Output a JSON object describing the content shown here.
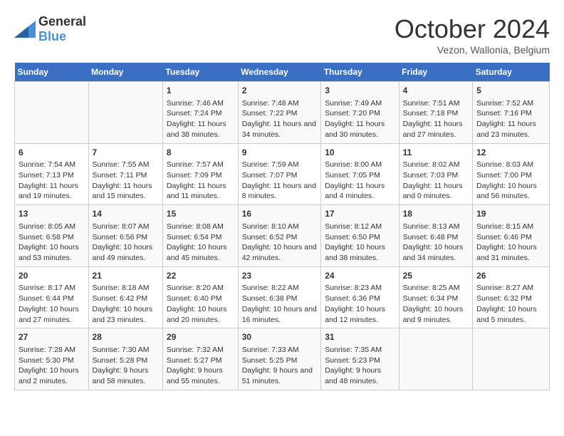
{
  "logo": {
    "text_general": "General",
    "text_blue": "Blue"
  },
  "title": "October 2024",
  "subtitle": "Vezon, Wallonia, Belgium",
  "days_of_week": [
    "Sunday",
    "Monday",
    "Tuesday",
    "Wednesday",
    "Thursday",
    "Friday",
    "Saturday"
  ],
  "weeks": [
    [
      {
        "day": "",
        "info": ""
      },
      {
        "day": "",
        "info": ""
      },
      {
        "day": "1",
        "info": "Sunrise: 7:46 AM\nSunset: 7:24 PM\nDaylight: 11 hours and 38 minutes."
      },
      {
        "day": "2",
        "info": "Sunrise: 7:48 AM\nSunset: 7:22 PM\nDaylight: 11 hours and 34 minutes."
      },
      {
        "day": "3",
        "info": "Sunrise: 7:49 AM\nSunset: 7:20 PM\nDaylight: 11 hours and 30 minutes."
      },
      {
        "day": "4",
        "info": "Sunrise: 7:51 AM\nSunset: 7:18 PM\nDaylight: 11 hours and 27 minutes."
      },
      {
        "day": "5",
        "info": "Sunrise: 7:52 AM\nSunset: 7:16 PM\nDaylight: 11 hours and 23 minutes."
      }
    ],
    [
      {
        "day": "6",
        "info": "Sunrise: 7:54 AM\nSunset: 7:13 PM\nDaylight: 11 hours and 19 minutes."
      },
      {
        "day": "7",
        "info": "Sunrise: 7:55 AM\nSunset: 7:11 PM\nDaylight: 11 hours and 15 minutes."
      },
      {
        "day": "8",
        "info": "Sunrise: 7:57 AM\nSunset: 7:09 PM\nDaylight: 11 hours and 11 minutes."
      },
      {
        "day": "9",
        "info": "Sunrise: 7:59 AM\nSunset: 7:07 PM\nDaylight: 11 hours and 8 minutes."
      },
      {
        "day": "10",
        "info": "Sunrise: 8:00 AM\nSunset: 7:05 PM\nDaylight: 11 hours and 4 minutes."
      },
      {
        "day": "11",
        "info": "Sunrise: 8:02 AM\nSunset: 7:03 PM\nDaylight: 11 hours and 0 minutes."
      },
      {
        "day": "12",
        "info": "Sunrise: 8:03 AM\nSunset: 7:00 PM\nDaylight: 10 hours and 56 minutes."
      }
    ],
    [
      {
        "day": "13",
        "info": "Sunrise: 8:05 AM\nSunset: 6:58 PM\nDaylight: 10 hours and 53 minutes."
      },
      {
        "day": "14",
        "info": "Sunrise: 8:07 AM\nSunset: 6:56 PM\nDaylight: 10 hours and 49 minutes."
      },
      {
        "day": "15",
        "info": "Sunrise: 8:08 AM\nSunset: 6:54 PM\nDaylight: 10 hours and 45 minutes."
      },
      {
        "day": "16",
        "info": "Sunrise: 8:10 AM\nSunset: 6:52 PM\nDaylight: 10 hours and 42 minutes."
      },
      {
        "day": "17",
        "info": "Sunrise: 8:12 AM\nSunset: 6:50 PM\nDaylight: 10 hours and 38 minutes."
      },
      {
        "day": "18",
        "info": "Sunrise: 8:13 AM\nSunset: 6:48 PM\nDaylight: 10 hours and 34 minutes."
      },
      {
        "day": "19",
        "info": "Sunrise: 8:15 AM\nSunset: 6:46 PM\nDaylight: 10 hours and 31 minutes."
      }
    ],
    [
      {
        "day": "20",
        "info": "Sunrise: 8:17 AM\nSunset: 6:44 PM\nDaylight: 10 hours and 27 minutes."
      },
      {
        "day": "21",
        "info": "Sunrise: 8:18 AM\nSunset: 6:42 PM\nDaylight: 10 hours and 23 minutes."
      },
      {
        "day": "22",
        "info": "Sunrise: 8:20 AM\nSunset: 6:40 PM\nDaylight: 10 hours and 20 minutes."
      },
      {
        "day": "23",
        "info": "Sunrise: 8:22 AM\nSunset: 6:38 PM\nDaylight: 10 hours and 16 minutes."
      },
      {
        "day": "24",
        "info": "Sunrise: 8:23 AM\nSunset: 6:36 PM\nDaylight: 10 hours and 12 minutes."
      },
      {
        "day": "25",
        "info": "Sunrise: 8:25 AM\nSunset: 6:34 PM\nDaylight: 10 hours and 9 minutes."
      },
      {
        "day": "26",
        "info": "Sunrise: 8:27 AM\nSunset: 6:32 PM\nDaylight: 10 hours and 5 minutes."
      }
    ],
    [
      {
        "day": "27",
        "info": "Sunrise: 7:28 AM\nSunset: 5:30 PM\nDaylight: 10 hours and 2 minutes."
      },
      {
        "day": "28",
        "info": "Sunrise: 7:30 AM\nSunset: 5:28 PM\nDaylight: 9 hours and 58 minutes."
      },
      {
        "day": "29",
        "info": "Sunrise: 7:32 AM\nSunset: 5:27 PM\nDaylight: 9 hours and 55 minutes."
      },
      {
        "day": "30",
        "info": "Sunrise: 7:33 AM\nSunset: 5:25 PM\nDaylight: 9 hours and 51 minutes."
      },
      {
        "day": "31",
        "info": "Sunrise: 7:35 AM\nSunset: 5:23 PM\nDaylight: 9 hours and 48 minutes."
      },
      {
        "day": "",
        "info": ""
      },
      {
        "day": "",
        "info": ""
      }
    ]
  ]
}
